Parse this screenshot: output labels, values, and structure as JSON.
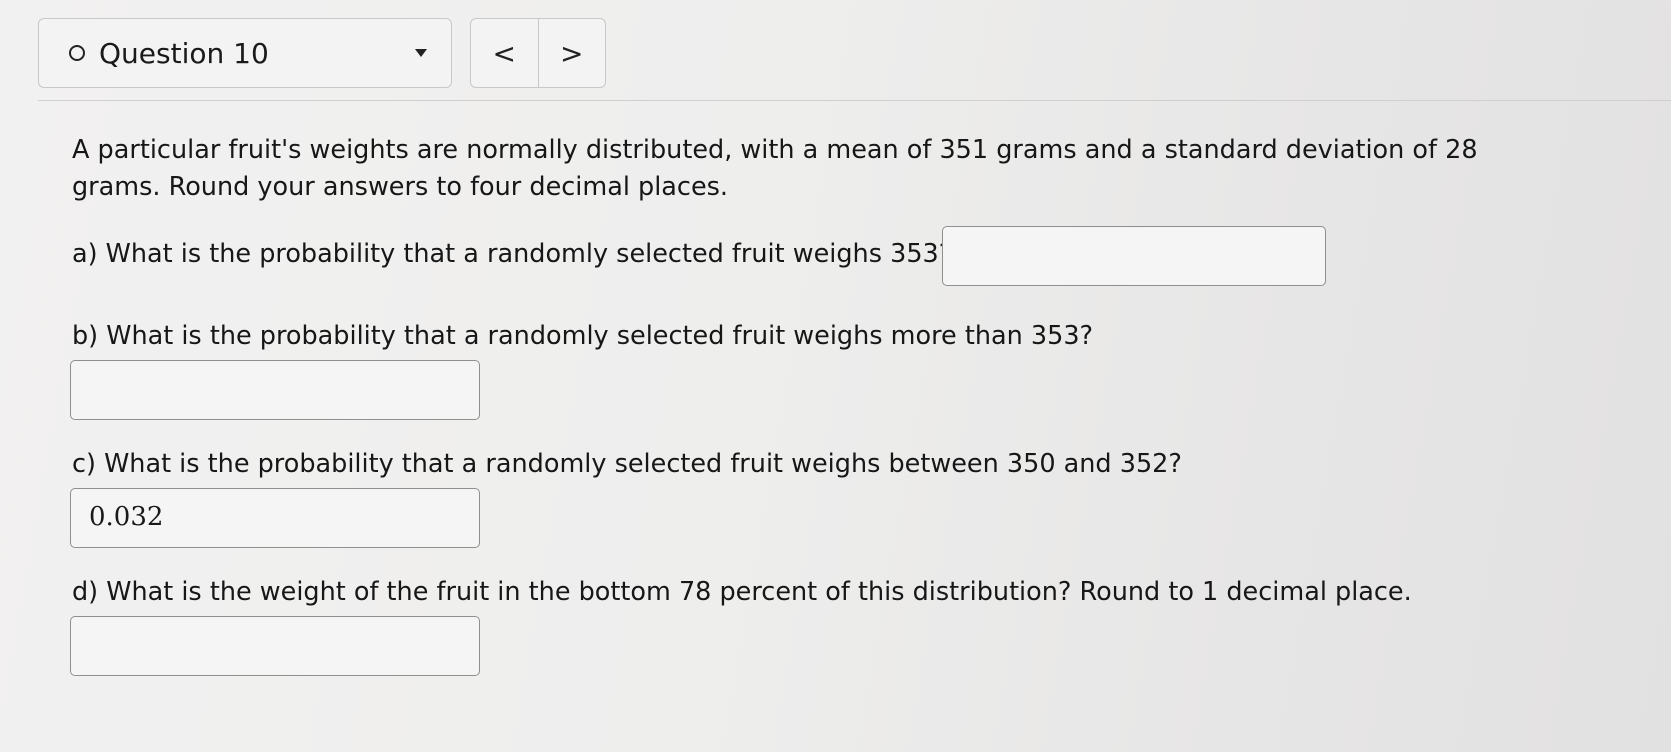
{
  "header": {
    "question_label": "Question 10",
    "prev_label": "<",
    "next_label": ">"
  },
  "problem": {
    "intro": "A particular fruit's weights are normally distributed, with a mean of 351 grams and a standard deviation of 28 grams. Round your answers to four decimal places.",
    "parts": [
      {
        "label": "a) What is the probability that a randomly selected fruit weighs 353?",
        "answer": ""
      },
      {
        "label": "b) What is the probability that a randomly selected fruit weighs more than 353?",
        "answer": ""
      },
      {
        "label": "c) What is the probability that a randomly selected fruit weighs between 350 and 352?",
        "answer": "0.032"
      },
      {
        "label": "d) What is the weight of the fruit in the bottom 78 percent of this distribution? Round to 1 decimal place.",
        "answer": ""
      }
    ]
  }
}
